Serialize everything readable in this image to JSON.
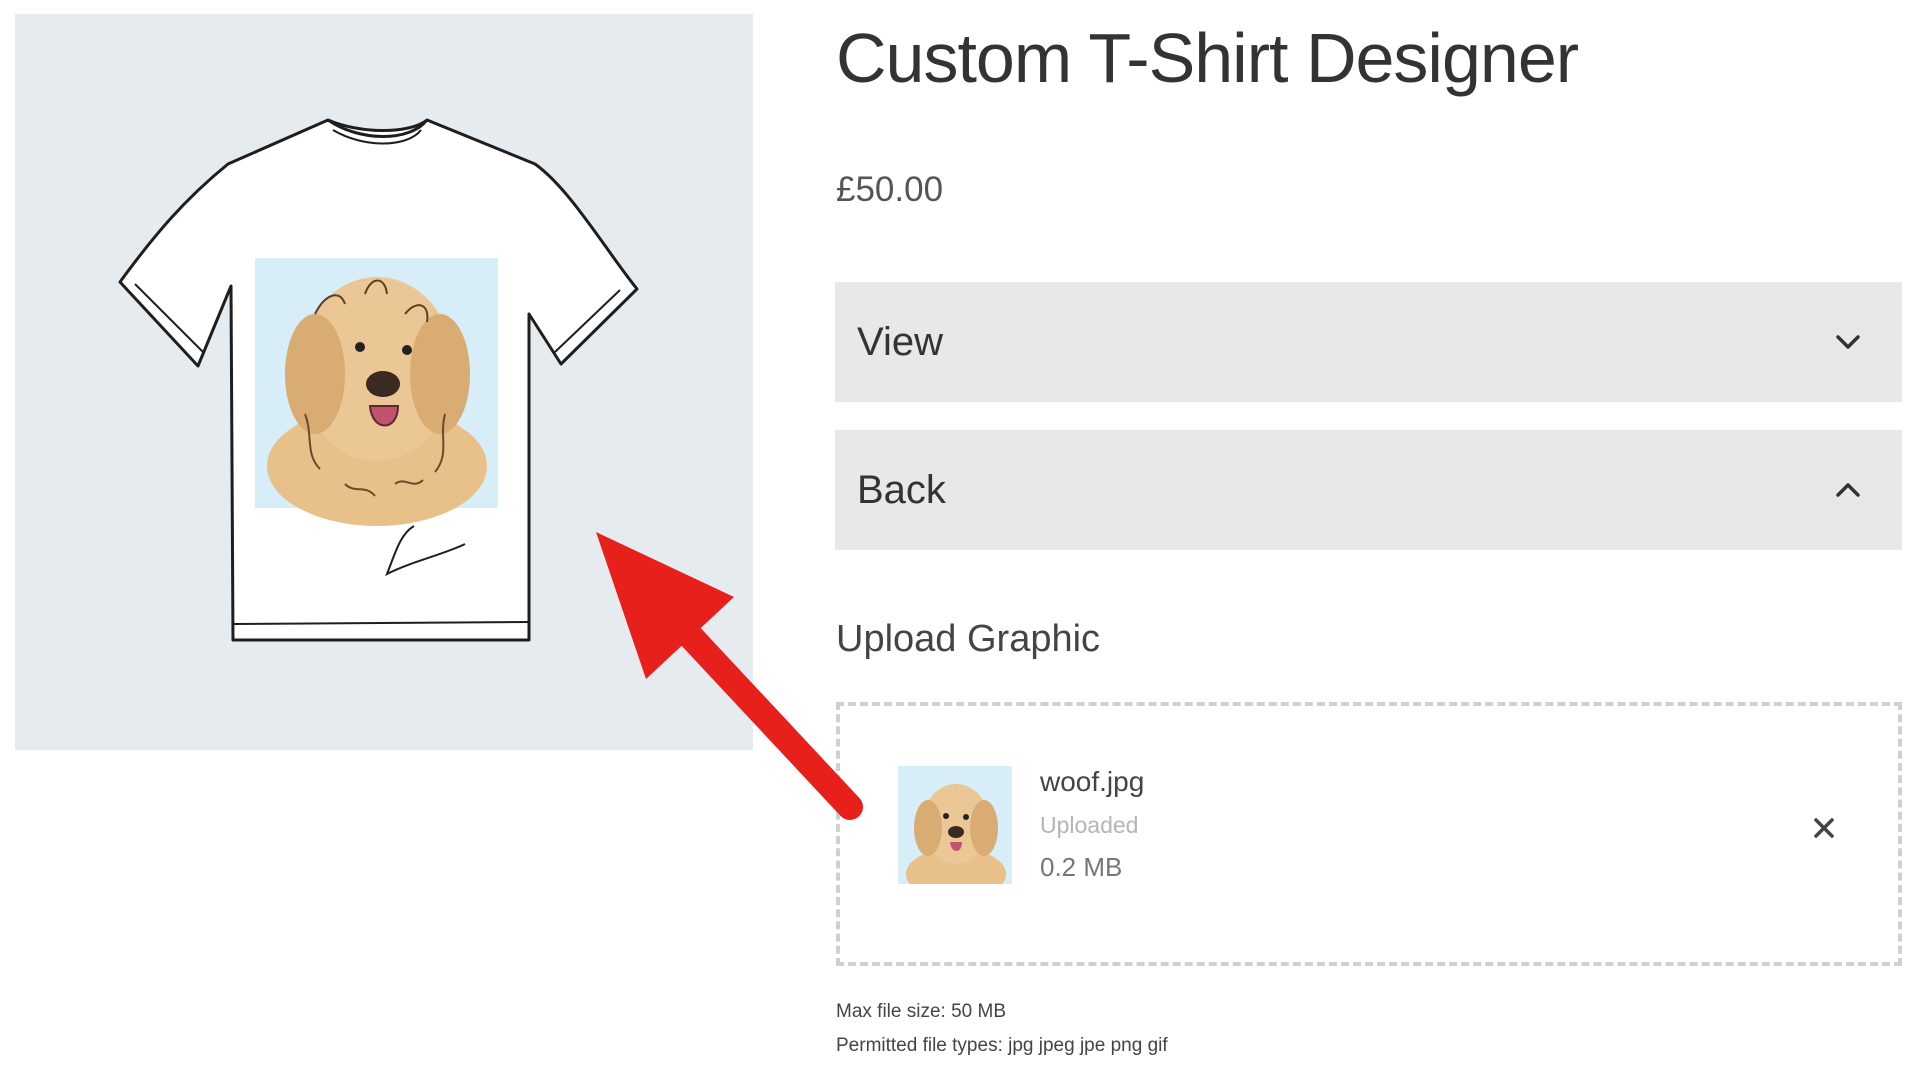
{
  "product": {
    "title": "Custom T-Shirt Designer",
    "price": "£50.00",
    "image_icon": "tshirt-with-dog-illustration"
  },
  "options": [
    {
      "label": "View",
      "state": "collapsed",
      "icon": "chevron-down-icon"
    },
    {
      "label": "Back",
      "state": "expanded",
      "icon": "chevron-up-icon"
    }
  ],
  "upload": {
    "label": "Upload Graphic",
    "file": {
      "name": "woof.jpg",
      "status": "Uploaded",
      "size": "0.2 MB",
      "remove_icon": "close-icon"
    },
    "max_size_note": "Max file size: 50 MB",
    "types_note": "Permitted file types: jpg jpeg jpe png gif"
  },
  "colors": {
    "accordion_bg": "#e8e8e8",
    "image_bg": "#e6ebf0",
    "arrow": "#e8201c",
    "dropzone_border": "#d0d0d0"
  }
}
